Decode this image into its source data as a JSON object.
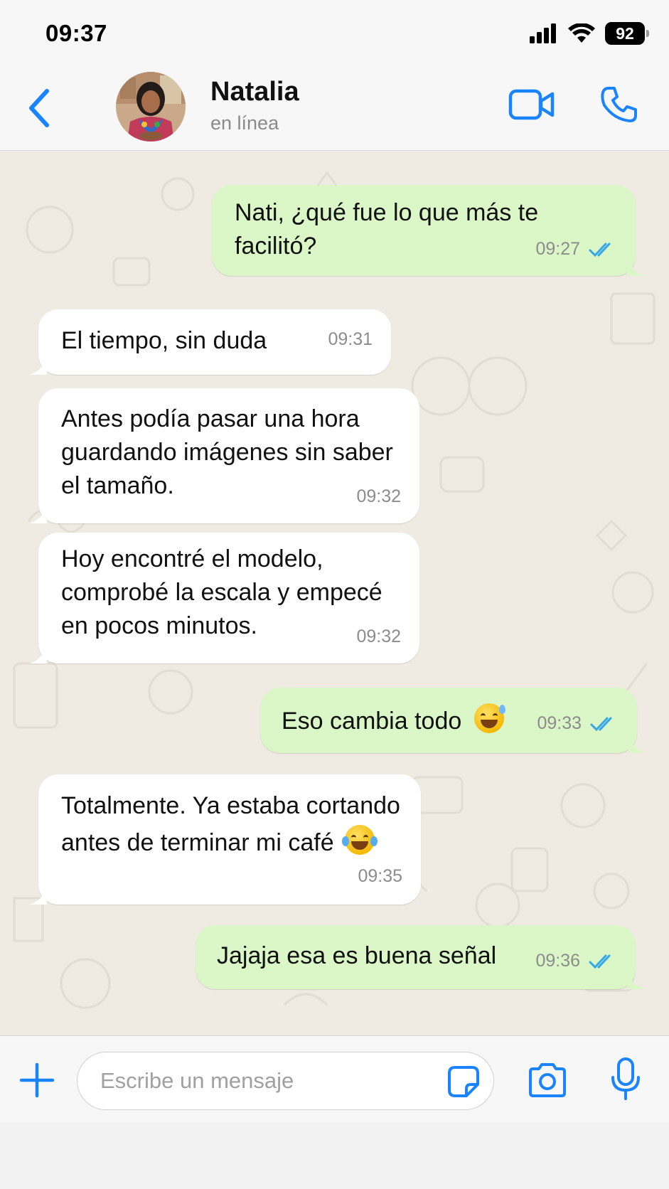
{
  "status_bar": {
    "time": "09:37",
    "battery": "92"
  },
  "header": {
    "contact_name": "Natalia",
    "contact_status": "en línea"
  },
  "messages": [
    {
      "direction": "out",
      "lines": [
        "Nati, ¿qué fue lo que más te",
        "facilitó?"
      ],
      "time": "09:27",
      "read": true
    },
    {
      "direction": "in",
      "lines": [
        "El tiempo, sin duda"
      ],
      "time": "09:31"
    },
    {
      "direction": "in",
      "lines": [
        "Antes podía pasar una hora",
        "guardando imágenes sin saber",
        "el tamaño."
      ],
      "time": "09:32"
    },
    {
      "direction": "in",
      "lines": [
        "Hoy encontré el modelo,",
        "comprobé la escala y empecé",
        "en pocos minutos."
      ],
      "time": "09:32"
    },
    {
      "direction": "out",
      "lines": [
        "Eso cambia todo"
      ],
      "emoji": "grinning-face-with-sweat",
      "time": "09:33",
      "read": true
    },
    {
      "direction": "in",
      "lines": [
        "Totalmente. Ya estaba cortando",
        "antes de terminar mi café"
      ],
      "emoji": "face-with-tears-of-joy",
      "time": "09:35"
    },
    {
      "direction": "out",
      "lines": [
        "Jajaja esa es buena señal"
      ],
      "time": "09:36",
      "read": true
    }
  ],
  "input_bar": {
    "placeholder": "Escribe un mensaje"
  },
  "colors": {
    "accent": "#1a84ff",
    "outgoing_bubble": "#dbf7c8",
    "incoming_bubble": "#ffffff",
    "chat_background": "#efeae2",
    "read_ticks": "#34a7e8"
  },
  "icons": {
    "back": "chevron-left-icon",
    "video": "video-camera-icon",
    "call": "phone-icon",
    "plus": "plus-icon",
    "sticker": "sticker-icon",
    "camera": "camera-icon",
    "mic": "microphone-icon"
  }
}
